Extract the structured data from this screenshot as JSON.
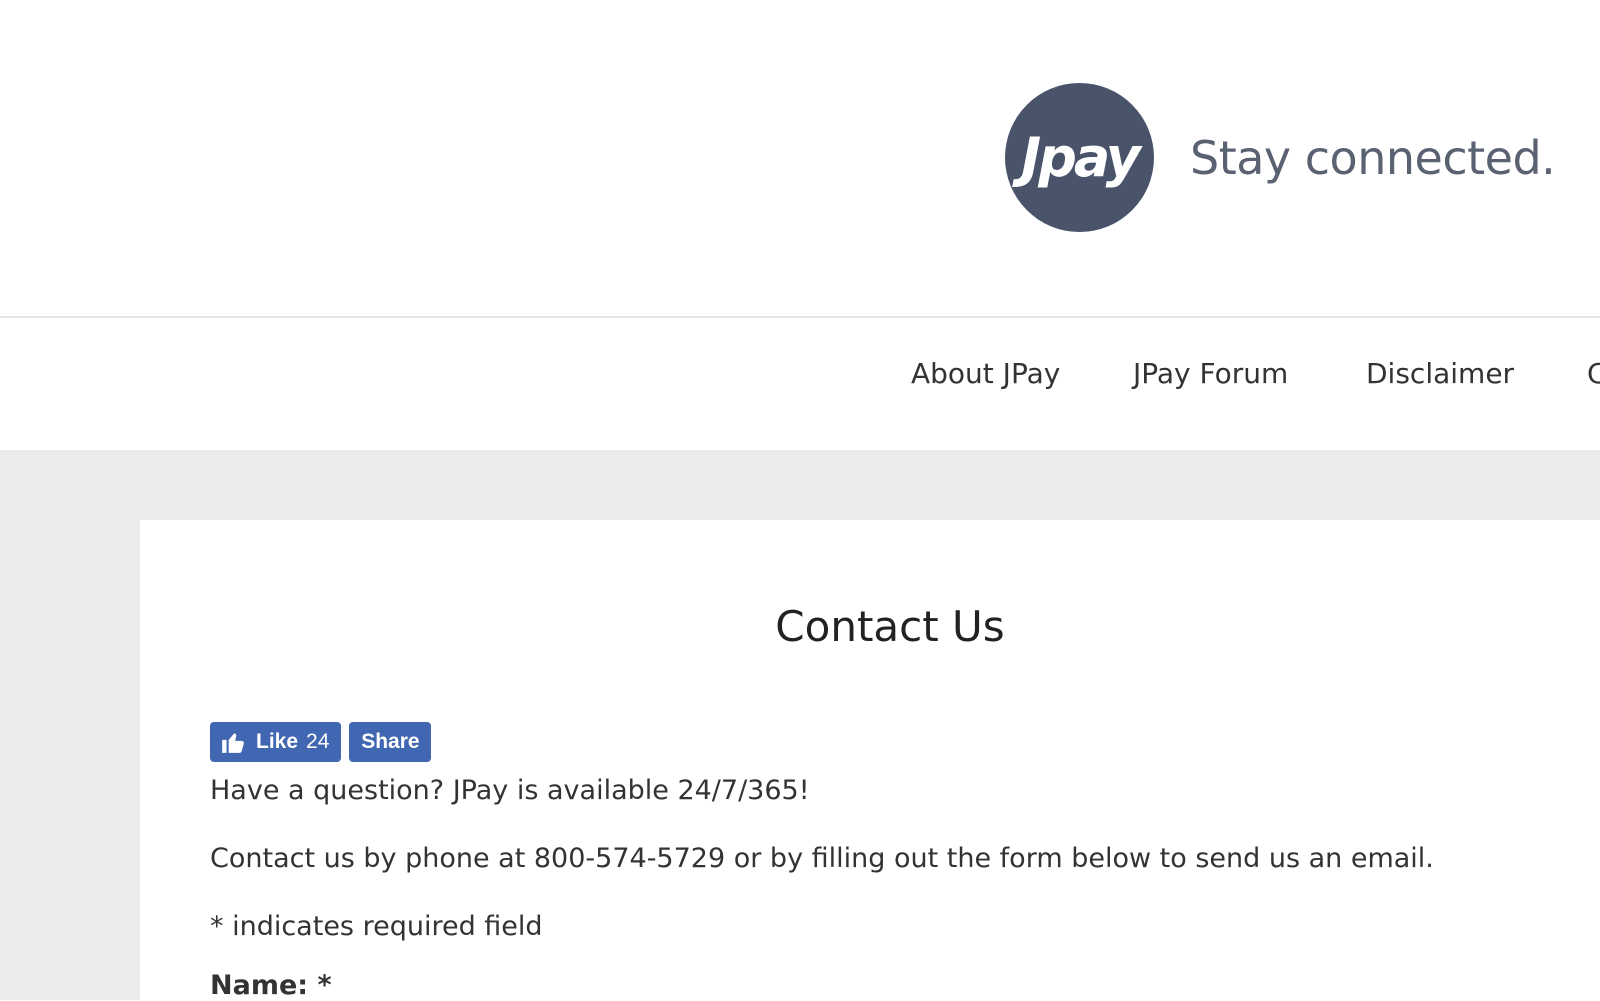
{
  "header": {
    "logo_text": "Jpay",
    "tagline": "Stay connected.",
    "brand_color": "#49546a"
  },
  "nav": {
    "items": [
      {
        "label": "About JPay"
      },
      {
        "label": "JPay Forum"
      },
      {
        "label": "Disclaimer"
      },
      {
        "label": "C"
      }
    ]
  },
  "main": {
    "title": "Contact Us",
    "facebook": {
      "like_label": "Like",
      "like_count": "24",
      "share_label": "Share",
      "color": "#4267b2"
    },
    "intro": "Have a question? JPay is available 24/7/365!",
    "contact_line": "Contact us by phone at 800-574-5729 or by filling out the form below to send us an email.",
    "required_note": "* indicates required field",
    "form": {
      "name_label": "Name: *"
    }
  }
}
